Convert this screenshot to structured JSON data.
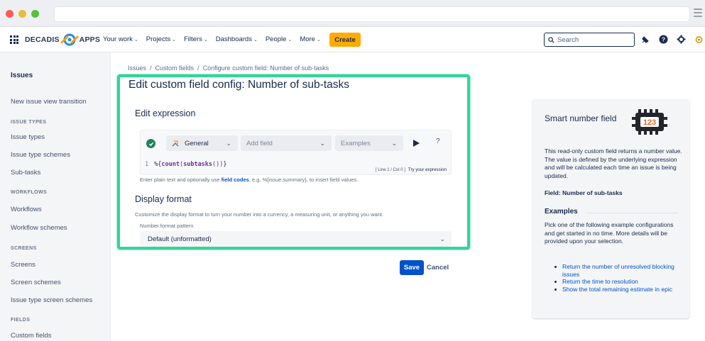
{
  "nav": {
    "logo_left": "DECADIS",
    "logo_right": "APPS",
    "items": [
      {
        "label": "Your work",
        "chevron": "chevron-down"
      },
      {
        "label": "Projects",
        "chevron": "chevron-down"
      },
      {
        "label": "Filters",
        "chevron": "chevron-down"
      },
      {
        "label": "Dashboards",
        "chevron": "chevron-down"
      },
      {
        "label": "People",
        "chevron": "chevron-down"
      },
      {
        "label": "More",
        "chevron": "chevron-down"
      }
    ],
    "create_label": "Create",
    "search_placeholder": "Search"
  },
  "sidebar": {
    "title": "Issues",
    "items": {
      "new_issue_view": "New issue view transition",
      "head_issue_types": "ISSUE TYPES",
      "issue_types": "Issue types",
      "issue_type_schemes": "Issue type schemes",
      "sub_tasks": "Sub-tasks",
      "head_workflows": "WORKFLOWS",
      "workflows": "Workflows",
      "workflow_schemes": "Workflow schemes",
      "head_screens": "SCREENS",
      "screens": "Screens",
      "screen_schemes": "Screen schemes",
      "issue_type_screen_schemes": "Issue type screen schemes",
      "head_fields": "FIELDS",
      "custom_fields": "Custom fields"
    }
  },
  "breadcrumb": {
    "b1": "Issues",
    "b2": "Custom fields",
    "b3": "Configure custom field: Number of sub-tasks",
    "sep": "/"
  },
  "main": {
    "title": "Edit custom field config: Number of sub-tasks",
    "expression_title": "Edit expression",
    "general_label": "General",
    "add_field_placeholder": "Add field",
    "examples_placeholder": "Examples",
    "help_label": "?",
    "line_number": "1",
    "code_prefix": "%{",
    "code_fn1": "count",
    "code_paren_open": "(",
    "code_fn2": "subtasks",
    "code_rest": "())",
    "code_suffix": "}",
    "cursor_pos": "[ Line 1 / Col 0 ]",
    "try_label": "Try your expression",
    "hint_before": "Enter plain text and optionally use ",
    "hint_link": "field codes",
    "hint_after": ", e.g. %{issue.summary}, to insert field values.",
    "display_format_title": "Display format",
    "display_format_desc": "Customize the display format to turn your number into a currency, a measuring unit, or anything you want.",
    "pattern_label": "Number format pattern",
    "pattern_value": "Default (unformatted)",
    "save_label": "Save",
    "cancel_label": "Cancel"
  },
  "panel": {
    "title": "Smart number field",
    "badge_text": "123",
    "description": "This read-only custom field returns a number value. The value is defined by the underlying expression and will be calculated each time an issue is being updated.",
    "field_line": "Field: Number of sub-tasks",
    "examples_title": "Examples",
    "examples_intro": "Pick one of the following example configurations and get started in no time. More details will be provided upon your selection.",
    "examples": [
      "Return the number of unresolved blocking issues",
      "Return the time to resolution",
      "Show the total remaining estimate in epic"
    ]
  },
  "colors": {
    "highlight": "#35d49a",
    "primary": "#0052cc",
    "create": "#ffab00"
  }
}
